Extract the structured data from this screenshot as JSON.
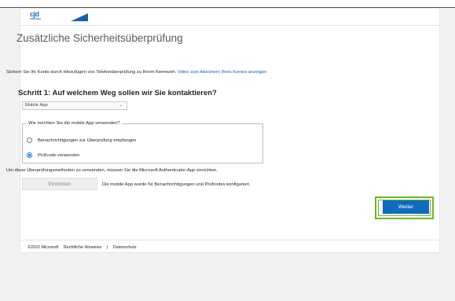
{
  "header": {
    "logo_text": "cjd"
  },
  "page": {
    "title": "Zusätzliche Sicherheitsüberprüfung",
    "intro_text": "Sichern Sie Ihr Konto durch Hinzufügen von Telefonüberprüfung zu Ihrem Kennwort.",
    "intro_link": "Video zum Absichern Ihres Kontos anzeigen"
  },
  "step": {
    "title": "Schritt 1: Auf welchem Weg sollen wir Sie kontaktieren?",
    "contact_method": "Mobile App"
  },
  "mobile_app": {
    "legend": "Wie möchten Sie die mobile App verwenden?",
    "option_notifications": "Benachrichtigungen zur Überprüfung empfangen",
    "option_code": "Prüfcode verwenden",
    "selected": "Prüfcode verwenden"
  },
  "auth_note": "Um diese Überprüfungsmethoden zu verwenden, müssen Sie die Microsoft Authenticator-App einrichten.",
  "setup": {
    "button_label": "Einrichten",
    "note": "Die mobile App wurde für Benachrichtigungen und Prüfcodes konfiguriert."
  },
  "actions": {
    "next_label": "Weiter"
  },
  "footer": {
    "copyright": "©2022 Microsoft",
    "legal": "Rechtliche Hinweise",
    "separator": "|",
    "privacy": "Datenschutz"
  },
  "colors": {
    "accent": "#0f6cbd",
    "highlight": "#6fb52c",
    "link": "#0b66c2"
  }
}
